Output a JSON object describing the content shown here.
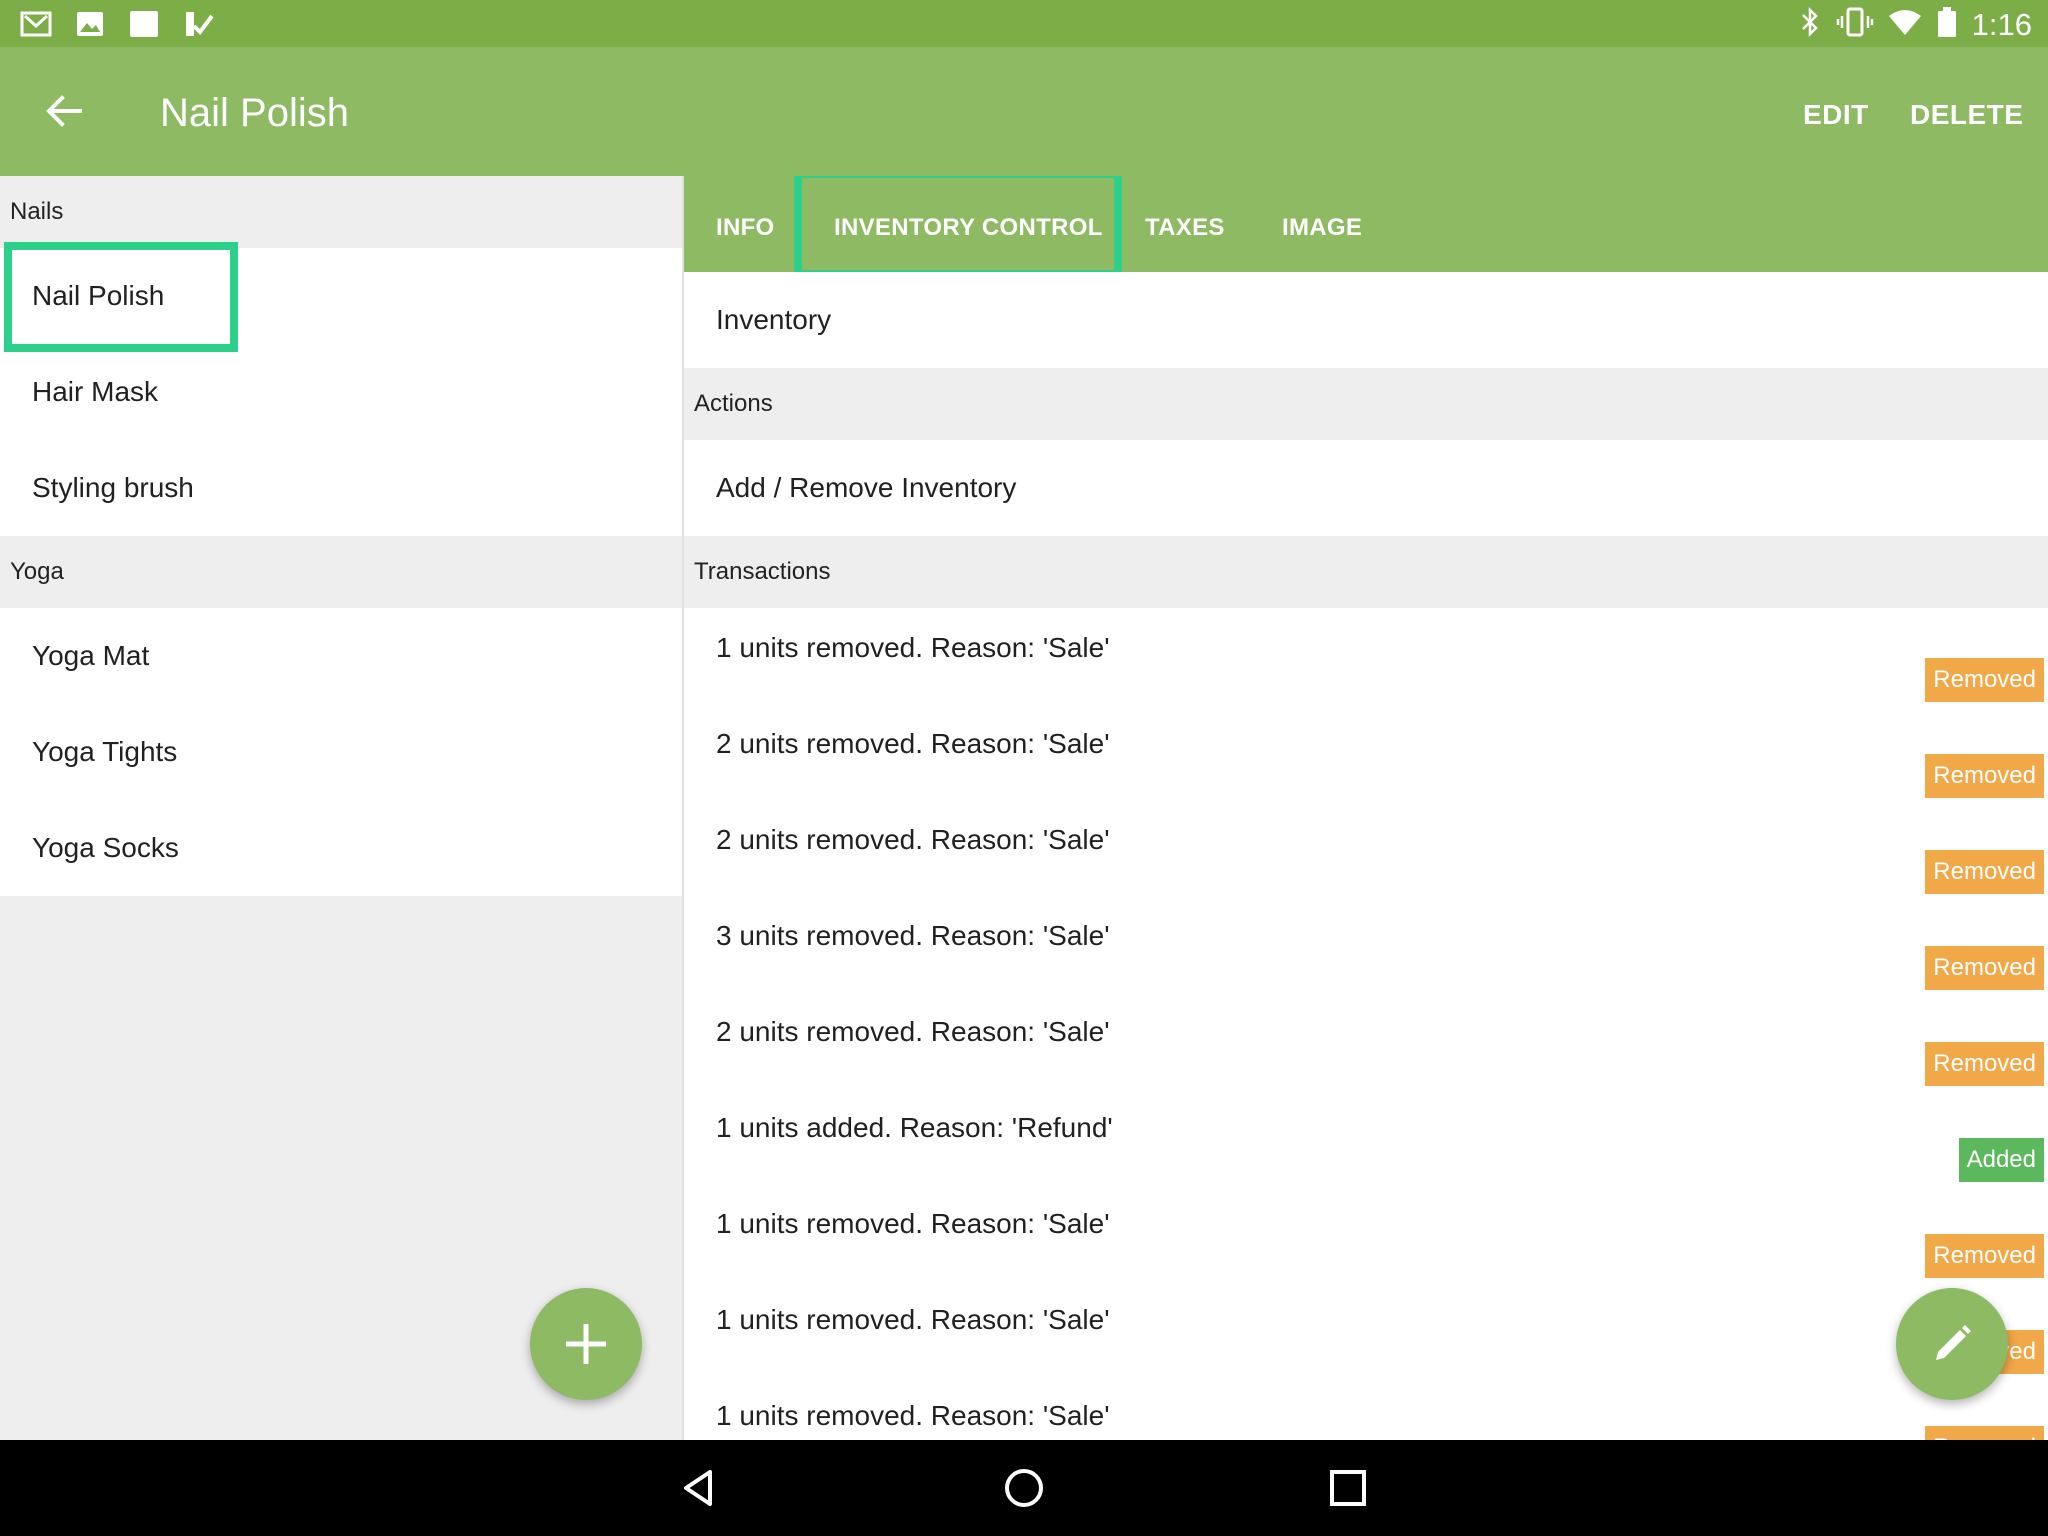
{
  "status_bar": {
    "time": "1:16",
    "left_icons": [
      "gmail-icon",
      "photos-icon",
      "blank-app-icon",
      "checkmark-app-icon"
    ],
    "right_icons": [
      "bluetooth-icon",
      "vibrate-icon",
      "wifi-icon",
      "battery-icon"
    ]
  },
  "app_bar": {
    "title": "Nail Polish",
    "edit_label": "EDIT",
    "delete_label": "DELETE",
    "primary_color": "#8dba62",
    "status_color": "#7cad46"
  },
  "sidebar": {
    "sections": [
      {
        "header": "Nails",
        "items": [
          "Nail Polish",
          "Hair Mask",
          "Styling brush"
        ]
      },
      {
        "header": "Yoga",
        "items": [
          "Yoga Mat",
          "Yoga Tights",
          "Yoga Socks"
        ]
      }
    ],
    "selected": "Nail Polish"
  },
  "tabs": {
    "items": [
      "INFO",
      "INVENTORY CONTROL",
      "TAXES",
      "IMAGE"
    ],
    "active": "INVENTORY CONTROL"
  },
  "detail": {
    "inventory_label": "Inventory",
    "actions_header": "Actions",
    "add_remove_label": "Add / Remove Inventory",
    "transactions_header": "Transactions",
    "transactions": [
      {
        "text": "1 units removed. Reason: 'Sale'",
        "badge": "Removed"
      },
      {
        "text": "2 units removed. Reason: 'Sale'",
        "badge": "Removed"
      },
      {
        "text": "2 units removed. Reason: 'Sale'",
        "badge": "Removed"
      },
      {
        "text": "3 units removed. Reason: 'Sale'",
        "badge": "Removed"
      },
      {
        "text": "2 units removed. Reason: 'Sale'",
        "badge": "Removed"
      },
      {
        "text": "1 units added. Reason: 'Refund'",
        "badge": "Added"
      },
      {
        "text": "1 units removed. Reason: 'Sale'",
        "badge": "Removed"
      },
      {
        "text": "1 units removed. Reason: 'Sale'",
        "badge": "Removed"
      },
      {
        "text": "1 units removed. Reason: 'Sale'",
        "badge": "Removed"
      }
    ],
    "badge_colors": {
      "Removed": "#f0a848",
      "Added": "#5cb85c"
    }
  },
  "highlight_color": "#2dd08a"
}
